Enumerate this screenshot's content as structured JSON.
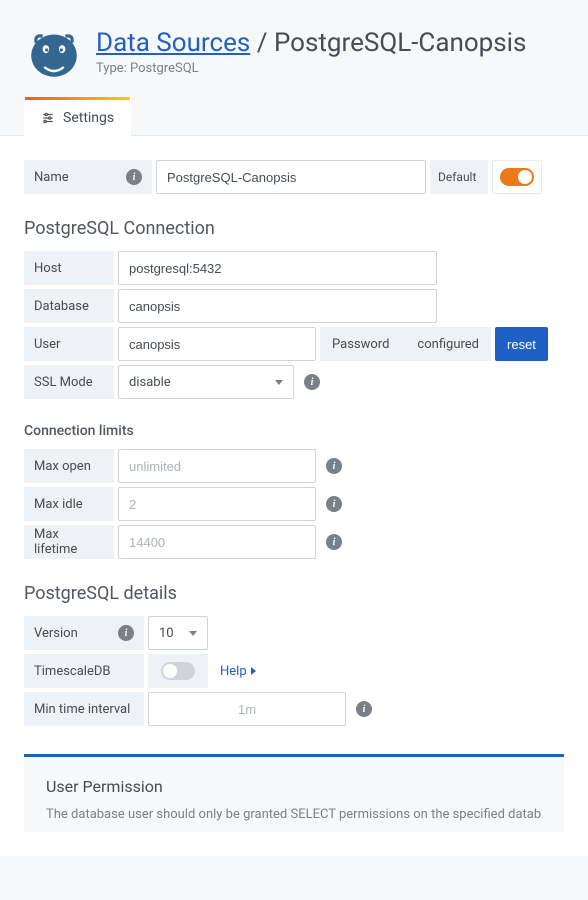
{
  "header": {
    "breadcrumb_root": "Data Sources",
    "breadcrumb_separator": " / ",
    "breadcrumb_current": "PostgreSQL-Canopsis",
    "type_label": "Type: PostgreSQL"
  },
  "tabs": {
    "settings": "Settings"
  },
  "form": {
    "name_label": "Name",
    "name_value": "PostgreSQL-Canopsis",
    "default_label": "Default",
    "default_on": true
  },
  "connection": {
    "title": "PostgreSQL Connection",
    "host_label": "Host",
    "host_value": "postgresql:5432",
    "database_label": "Database",
    "database_value": "canopsis",
    "user_label": "User",
    "user_value": "canopsis",
    "password_label": "Password",
    "password_status": "configured",
    "reset_label": "reset",
    "ssl_label": "SSL Mode",
    "ssl_value": "disable"
  },
  "limits": {
    "title": "Connection limits",
    "max_open_label": "Max open",
    "max_open_placeholder": "unlimited",
    "max_idle_label": "Max idle",
    "max_idle_placeholder": "2",
    "max_life_label": "Max lifetime",
    "max_life_placeholder": "14400"
  },
  "details": {
    "title": "PostgreSQL details",
    "version_label": "Version",
    "version_value": "10",
    "timescale_label": "TimescaleDB",
    "timescale_on": false,
    "help_label": "Help",
    "min_time_label": "Min time interval",
    "min_time_placeholder": "1m"
  },
  "permissions": {
    "title": "User Permission",
    "text": "The database user should only be granted SELECT permissions on the specified database"
  }
}
